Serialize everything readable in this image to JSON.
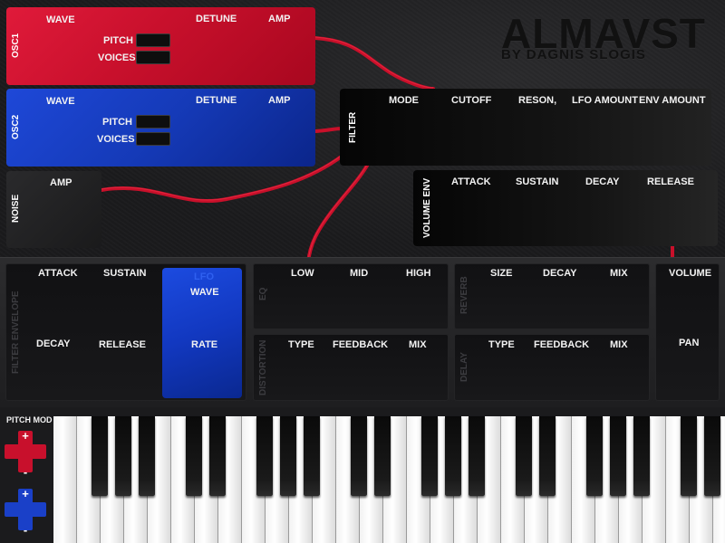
{
  "app": {
    "logo": "ALMAVST",
    "byline": "BY DAGNIS SLOGIS"
  },
  "colors": {
    "osc1": "#c8102c",
    "osc2": "#153ab8",
    "cable": "#d0102a",
    "lfo": "#1238c0"
  },
  "osc1": {
    "title": "OSC1",
    "wave": "WAVE",
    "detune": "DETUNE",
    "amp": "AMP",
    "pitch": "PITCH",
    "voices": "VOICES"
  },
  "osc2": {
    "title": "OSC2",
    "wave": "WAVE",
    "detune": "DETUNE",
    "amp": "AMP",
    "pitch": "PITCH",
    "voices": "VOICES"
  },
  "noise": {
    "title": "NOISE",
    "amp": "AMP"
  },
  "filter": {
    "title": "FILTER",
    "mode": "MODE",
    "cutoff": "CUTOFF",
    "reson": "RESON,",
    "lfo_amount": "LFO AMOUNT",
    "env_amount": "ENV AMOUNT"
  },
  "volume_env": {
    "title": "VOLUME ENV",
    "attack": "ATTACK",
    "sustain": "SUSTAIN",
    "decay": "DECAY",
    "release": "RELEASE"
  },
  "filter_env": {
    "title": "FILTER ENVELOPE",
    "attack": "ATTACK",
    "sustain": "SUSTAIN",
    "decay": "DECAY",
    "release": "RELEASE"
  },
  "lfo": {
    "title": "LFO",
    "wave": "WAVE",
    "rate": "RATE"
  },
  "eq": {
    "title": "EQ",
    "low": "LOW",
    "mid": "MID",
    "high": "HIGH"
  },
  "distortion": {
    "title": "DISTORTION",
    "type": "TYPE",
    "feedback": "FEEDBACK",
    "mix": "MIX"
  },
  "reverb": {
    "title": "REVERB",
    "size": "SIZE",
    "decay": "DECAY",
    "mix": "MIX"
  },
  "delay": {
    "title": "DELAY",
    "type": "TYPE",
    "feedback": "FEEDBACK",
    "mix": "MIX"
  },
  "master": {
    "volume": "VOLUME",
    "pan": "PAN"
  },
  "pitch_mod": {
    "title": "PITCH MOD",
    "plus": "+",
    "minus": "-"
  },
  "keyboard": {
    "white_keys": 29
  }
}
